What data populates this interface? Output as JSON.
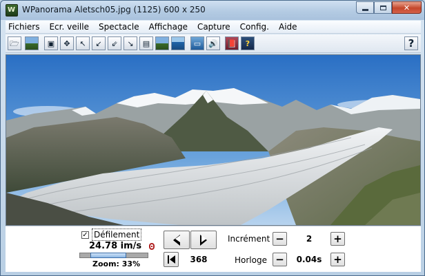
{
  "window": {
    "title": "WPanorama  Aletsch05.jpg    (1125) 600 x 250",
    "minimize_icon": "minimize-icon",
    "maximize_icon": "maximize-icon",
    "close_label": "✕"
  },
  "menu": {
    "items": [
      "Fichiers",
      "Ecr. veille",
      "Spectacle",
      "Affichage",
      "Capture",
      "Config.",
      "Aide"
    ]
  },
  "toolbar": {
    "buttons": [
      {
        "icon": "open-file-icon",
        "glyph": "🗁"
      },
      {
        "icon": "landscape-image-icon",
        "glyph": ""
      },
      {
        "icon": "fit-window-icon",
        "glyph": "▣"
      },
      {
        "icon": "move-arrows-icon",
        "glyph": "✥"
      },
      {
        "icon": "arrow-up-left-icon",
        "glyph": "↖"
      },
      {
        "icon": "arrow-down-left-icon",
        "glyph": "↙"
      },
      {
        "icon": "arrow-down-left-alt-icon",
        "glyph": "⇙"
      },
      {
        "icon": "arrow-down-right-icon",
        "glyph": "↘"
      },
      {
        "icon": "panorama-frame-icon",
        "glyph": "▤"
      },
      {
        "icon": "mountain-scene-icon",
        "glyph": ""
      },
      {
        "icon": "water-scene-icon",
        "glyph": ""
      },
      {
        "icon": "ground-scene-icon",
        "glyph": "▭"
      },
      {
        "icon": "speaker-icon",
        "glyph": "🔊"
      },
      {
        "icon": "book-icon",
        "glyph": "📕"
      },
      {
        "icon": "help-book-icon",
        "glyph": "?"
      },
      {
        "icon": "help-icon",
        "glyph": "?"
      }
    ]
  },
  "controls": {
    "scroll_checkbox_mark": "✓",
    "scroll_label": "Défilement",
    "speed": "24.78 im/s",
    "zoom_label": "Zoom: 33%",
    "zoom_fraction": 0.33,
    "position_value": "368",
    "increment_label": "Incrément",
    "increment_value": "2",
    "clock_label": "Horloge",
    "clock_value": "0.04s",
    "minus_glyph": "−",
    "plus_glyph": "+"
  },
  "colors": {
    "sky_top": "#2f74c8",
    "sky_bottom": "#9cc4ea",
    "glacier": "#dfe3e6",
    "rock": "#6b6a5e"
  }
}
